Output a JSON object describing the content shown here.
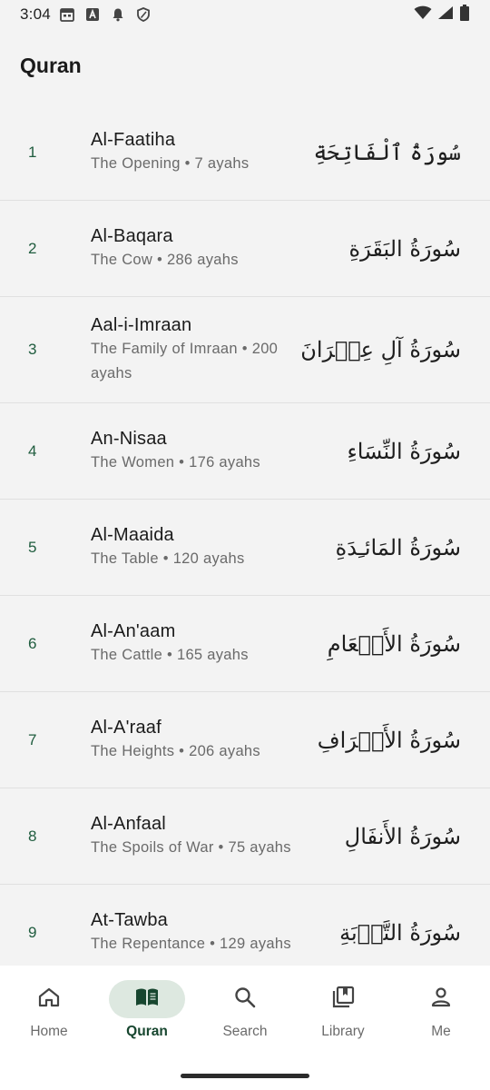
{
  "status_bar": {
    "time": "3:04",
    "left_icons": [
      "calendar-icon",
      "a-square-icon",
      "bell-icon",
      "shield-icon"
    ],
    "right_icons": [
      "wifi-icon",
      "signal-icon",
      "battery-icon"
    ]
  },
  "app_bar": {
    "title": "Quran"
  },
  "colors": {
    "accent": "#1f5c3e",
    "nav_active_bg": "#dde8e0",
    "background": "#f3f3f3"
  },
  "surahs": [
    {
      "number": "1",
      "name": "Al-Faatiha",
      "meta": "The Opening • 7 ayahs",
      "arabic": "سُورَةُ ٱلْفَاتِحَةِ"
    },
    {
      "number": "2",
      "name": "Al-Baqara",
      "meta": "The Cow • 286 ayahs",
      "arabic": "سُورَةُ البَقَرَةِ"
    },
    {
      "number": "3",
      "name": "Aal-i-Imraan",
      "meta": "The Family of Imraan • 200 ayahs",
      "arabic": "سُورَةُ آلِ عِمۡرَانَ"
    },
    {
      "number": "4",
      "name": "An-Nisaa",
      "meta": "The Women • 176 ayahs",
      "arabic": "سُورَةُ النِّسَاءِ"
    },
    {
      "number": "5",
      "name": "Al-Maaida",
      "meta": "The Table • 120 ayahs",
      "arabic": "سُورَةُ المَائـِدَةِ"
    },
    {
      "number": "6",
      "name": "Al-An'aam",
      "meta": "The Cattle • 165 ayahs",
      "arabic": "سُورَةُ الأَنۡعَامِ"
    },
    {
      "number": "7",
      "name": "Al-A'raaf",
      "meta": "The Heights • 206 ayahs",
      "arabic": "سُورَةُ الأَعۡرَافِ"
    },
    {
      "number": "8",
      "name": "Al-Anfaal",
      "meta": "The Spoils of War • 75 ayahs",
      "arabic": "سُورَةُ الأَنفَالِ"
    },
    {
      "number": "9",
      "name": "At-Tawba",
      "meta": "The Repentance • 129 ayahs",
      "arabic": "سُورَةُ التَّوۡبَةِ"
    }
  ],
  "bottom_nav": {
    "items": [
      {
        "label": "Home",
        "icon": "home-icon",
        "active": false
      },
      {
        "label": "Quran",
        "icon": "book-icon",
        "active": true
      },
      {
        "label": "Search",
        "icon": "search-icon",
        "active": false
      },
      {
        "label": "Library",
        "icon": "library-icon",
        "active": false
      },
      {
        "label": "Me",
        "icon": "person-icon",
        "active": false
      }
    ]
  }
}
